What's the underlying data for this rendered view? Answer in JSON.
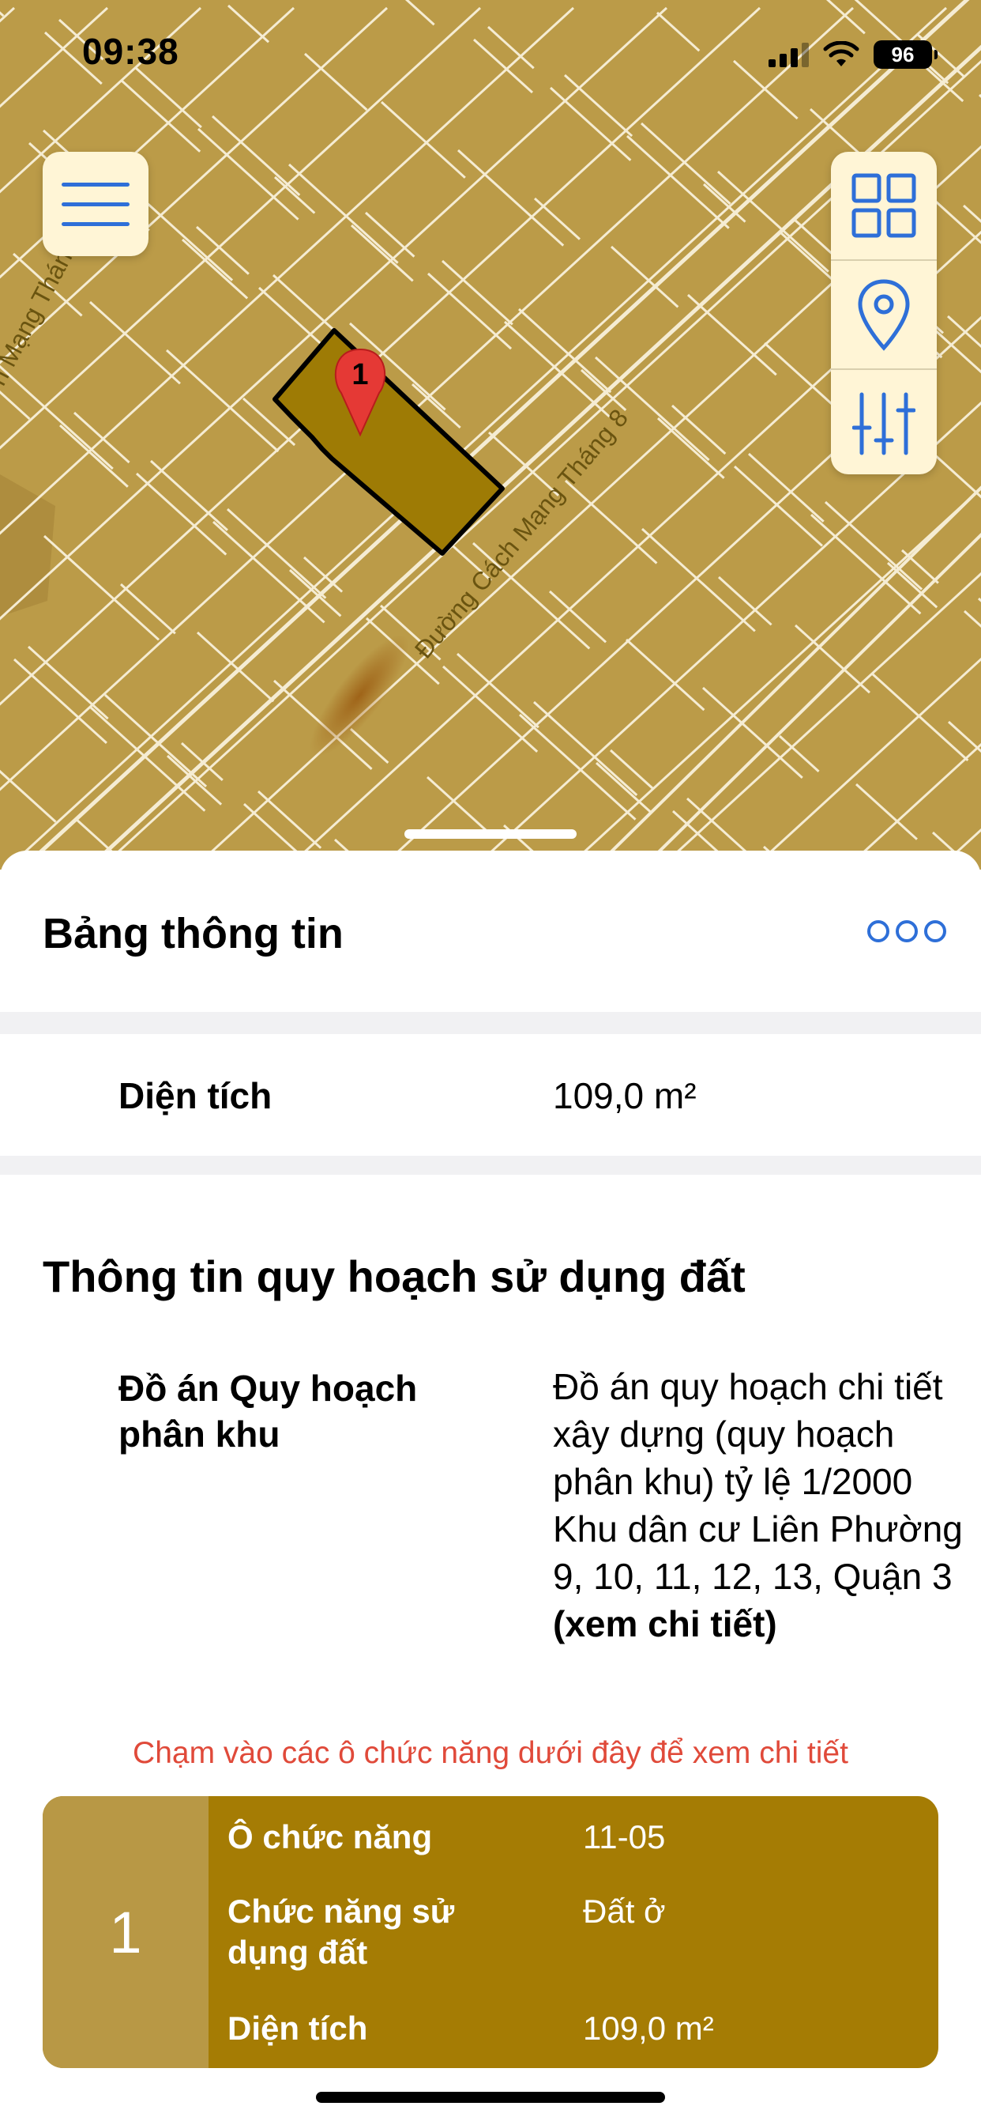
{
  "status_bar": {
    "time": "09:38",
    "battery": "96"
  },
  "map": {
    "street_main": "Đường Cách Mạng Tháng 8",
    "street_side": "h Mạng Tháng",
    "marker_label": "1",
    "colors": {
      "land": "#bb9b48",
      "lines": "#f5ecd3",
      "selected": "#9e7b05"
    }
  },
  "icons": {
    "menu": "menu-icon",
    "layers": "grid-icon",
    "location": "location-pin-icon",
    "filters": "sliders-icon",
    "more": "more-dots-icon"
  },
  "panel": {
    "title": "Bảng thông tin",
    "area_label": "Diện tích",
    "area_value": "109,0 m²",
    "planning_title": "Thông tin quy hoạch sử dụng đất",
    "plan_label": "Đồ án Quy hoạch phân khu",
    "plan_value": "Đồ án quy hoạch chi tiết xây dựng (quy hoạch phân khu) tỷ lệ 1/2000 Khu dân cư Liên Phường 9, 10, 11, 12, 13, Quận 3",
    "plan_link": "(xem chi tiết)",
    "hint": "Chạm vào các ô chức năng dưới đây để xem chi tiết"
  },
  "function_cell": {
    "number": "1",
    "rows": [
      {
        "label": "Ô chức năng",
        "value": "11-05"
      },
      {
        "label": "Chức năng sử dụng đất",
        "value": "Đất ở"
      },
      {
        "label": "Diện tích",
        "value": "109,0 m²"
      }
    ]
  }
}
